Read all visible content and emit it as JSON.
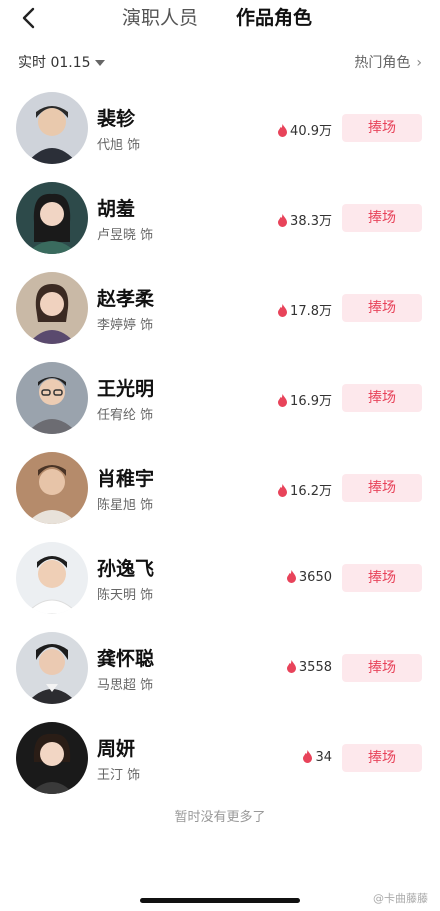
{
  "header": {
    "tab_cast": "演职人员",
    "tab_roles": "作品角色"
  },
  "filter": {
    "realtime_label": "实时 01.15",
    "hot_roles_label": "热门角色"
  },
  "roles": [
    {
      "name": "裴轸",
      "actor": "代旭 饰",
      "heat": "40.9万",
      "cheer": "捧场"
    },
    {
      "name": "胡羞",
      "actor": "卢昱晓 饰",
      "heat": "38.3万",
      "cheer": "捧场"
    },
    {
      "name": "赵孝柔",
      "actor": "李婷婷 饰",
      "heat": "17.8万",
      "cheer": "捧场"
    },
    {
      "name": "王光明",
      "actor": "任宥纶 饰",
      "heat": "16.9万",
      "cheer": "捧场"
    },
    {
      "name": "肖稚宇",
      "actor": "陈星旭 饰",
      "heat": "16.2万",
      "cheer": "捧场"
    },
    {
      "name": "孙逸飞",
      "actor": "陈天明 饰",
      "heat": "3650",
      "cheer": "捧场"
    },
    {
      "name": "龚怀聪",
      "actor": "马思超 饰",
      "heat": "3558",
      "cheer": "捧场"
    },
    {
      "name": "周妍",
      "actor": "王汀 饰",
      "heat": "34",
      "cheer": "捧场"
    }
  ],
  "footer": {
    "no_more": "暂时没有更多了",
    "watermark": "@卡曲藤藤"
  },
  "colors": {
    "accent": "#e8435a",
    "cheer_bg": "#fde8ec"
  }
}
